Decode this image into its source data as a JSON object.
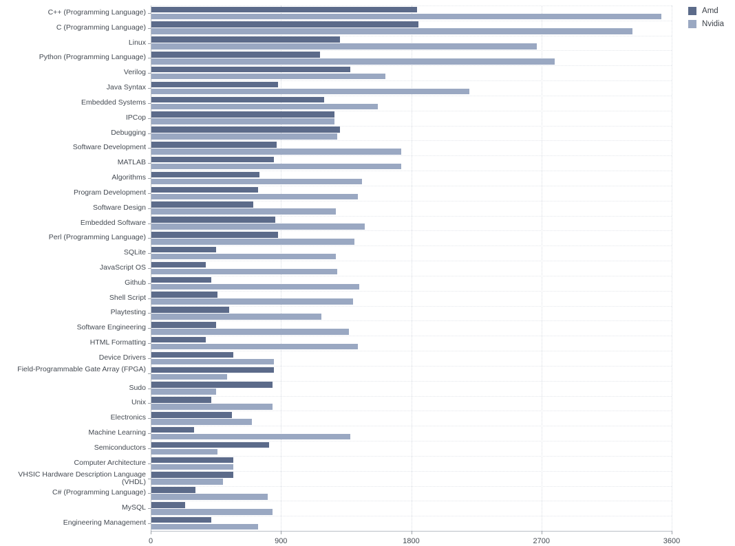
{
  "legend": {
    "position": "top-right",
    "entries": [
      {
        "label": "Amd",
        "color": "#5c6b8a"
      },
      {
        "label": "Nvidia",
        "color": "#9aa8c2"
      }
    ]
  },
  "axis": {
    "x_ticks": [
      "0",
      "900",
      "1800",
      "2700",
      "3600"
    ],
    "x_min": 0,
    "x_max": 3600
  },
  "chart_data": {
    "type": "bar",
    "orientation": "horizontal",
    "title": "",
    "xlabel": "",
    "ylabel": "",
    "xlim": [
      0,
      3600
    ],
    "grid": true,
    "legend_position": "top-right",
    "categories": [
      "C++ (Programming Language)",
      "C (Programming Language)",
      "Linux",
      "Python (Programming Language)",
      "Verilog",
      "Java Syntax",
      "Embedded Systems",
      "IPCop",
      "Debugging",
      "Software Development",
      "MATLAB",
      "Algorithms",
      "Program Development",
      "Software Design",
      "Embedded Software",
      "Perl (Programming Language)",
      "SQLite",
      "JavaScript OS",
      "Github",
      "Shell Script",
      "Playtesting",
      "Software Engineering",
      "HTML Formatting",
      "Device Drivers",
      "Field-Programmable Gate Array (FPGA)",
      "Sudo",
      "Unix",
      "Electronics",
      "Machine Learning",
      "Semiconductors",
      "Computer Architecture",
      "VHSIC Hardware Description Language (VHDL)",
      "C# (Programming Language)",
      "MySQL",
      "Engineering Management"
    ],
    "series": [
      {
        "name": "Amd",
        "color": "#5c6b8a",
        "values": [
          1840,
          1850,
          1310,
          1170,
          1380,
          880,
          1200,
          1270,
          1310,
          870,
          850,
          750,
          740,
          710,
          860,
          880,
          450,
          380,
          420,
          460,
          540,
          450,
          380,
          570,
          850,
          840,
          420,
          560,
          300,
          820,
          570,
          570,
          310,
          240,
          420
        ]
      },
      {
        "name": "Nvidia",
        "color": "#9aa8c2",
        "values": [
          3530,
          3330,
          2670,
          2790,
          1620,
          2200,
          1570,
          1270,
          1290,
          1730,
          1730,
          1460,
          1430,
          1280,
          1480,
          1410,
          1280,
          1290,
          1440,
          1400,
          1180,
          1370,
          1430,
          850,
          530,
          450,
          840,
          700,
          1380,
          460,
          570,
          500,
          810,
          840,
          740
        ]
      }
    ]
  }
}
